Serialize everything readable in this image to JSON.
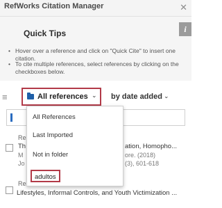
{
  "app": {
    "title": "RefWorks Citation Manager",
    "close_glyph": "✕"
  },
  "quick_tips": {
    "title": "Quick Tips",
    "info_glyph": "i",
    "tips": [
      "Hover over a reference and click on \"Quick Cite\" to insert one citation.",
      "To cite multiple references, select references by clicking on the checkboxes below."
    ]
  },
  "toolbar": {
    "menu_glyph": "≡",
    "folder_select": {
      "label": "All references",
      "chevron": "⌄"
    },
    "sort_select": {
      "label": "by date added",
      "chevron": "⌄"
    },
    "search": {
      "placeholder": ""
    }
  },
  "folder_menu": {
    "items": [
      "All References",
      "Last Imported",
      "Not in folder",
      "adultos"
    ],
    "highlighted": "adultos"
  },
  "references": [
    {
      "visible_fragments": [
        "Re",
        "Th",
        "M",
        "Jo"
      ],
      "right_fragments": [
        "ation, Homopho...",
        "ore. (2018)",
        "(3), 601-618"
      ]
    },
    {
      "visible_fragments": [
        "Re",
        "Lifestyles, Informal Controls, and Youth Victimization ..."
      ]
    }
  ],
  "colors": {
    "highlight_border": "#b23a48",
    "folder_icon": "#1f5fa8",
    "tips_background": "#f5f5f5"
  },
  "icons": [
    "close-icon",
    "info-icon",
    "hamburger-menu-icon",
    "folder-icon",
    "chevron-down-icon",
    "search-icon"
  ]
}
